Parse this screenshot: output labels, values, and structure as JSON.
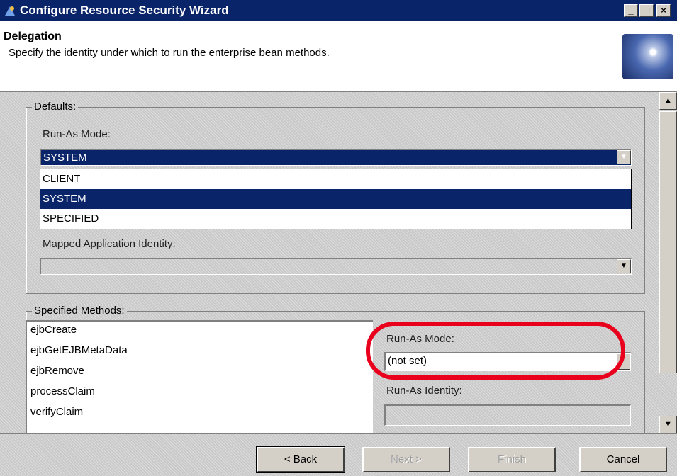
{
  "window": {
    "title": "Configure Resource Security Wizard",
    "controls": {
      "minimize": "_",
      "maximize": "□",
      "close": "×"
    }
  },
  "header": {
    "title": "Delegation",
    "description": "Specify the identity under which to run the enterprise bean methods."
  },
  "defaults": {
    "legend": "Defaults:",
    "run_as_mode_label": "Run-As Mode:",
    "run_as_mode_value": "SYSTEM",
    "run_as_mode_options": [
      "CLIENT",
      "SYSTEM",
      "SPECIFIED"
    ],
    "mapped_identity_label": "Mapped Application Identity:",
    "mapped_identity_value": ""
  },
  "specified_methods": {
    "legend": "Specified Methods:",
    "methods": [
      "ejbCreate",
      "ejbGetEJBMetaData",
      "ejbRemove",
      "processClaim",
      "verifyClaim"
    ],
    "run_as_mode_label": "Run-As Mode:",
    "run_as_mode_value": "(not set)",
    "run_as_identity_label": "Run-As Identity:",
    "run_as_identity_value": ""
  },
  "buttons": {
    "back": "< Back",
    "next": "Next >",
    "finish": "Finish",
    "cancel": "Cancel"
  },
  "annotation": {
    "color": "#e8001c"
  },
  "colors": {
    "title_bar": "#0a246a",
    "selection": "#0a246a",
    "face": "#d4d0c8"
  }
}
